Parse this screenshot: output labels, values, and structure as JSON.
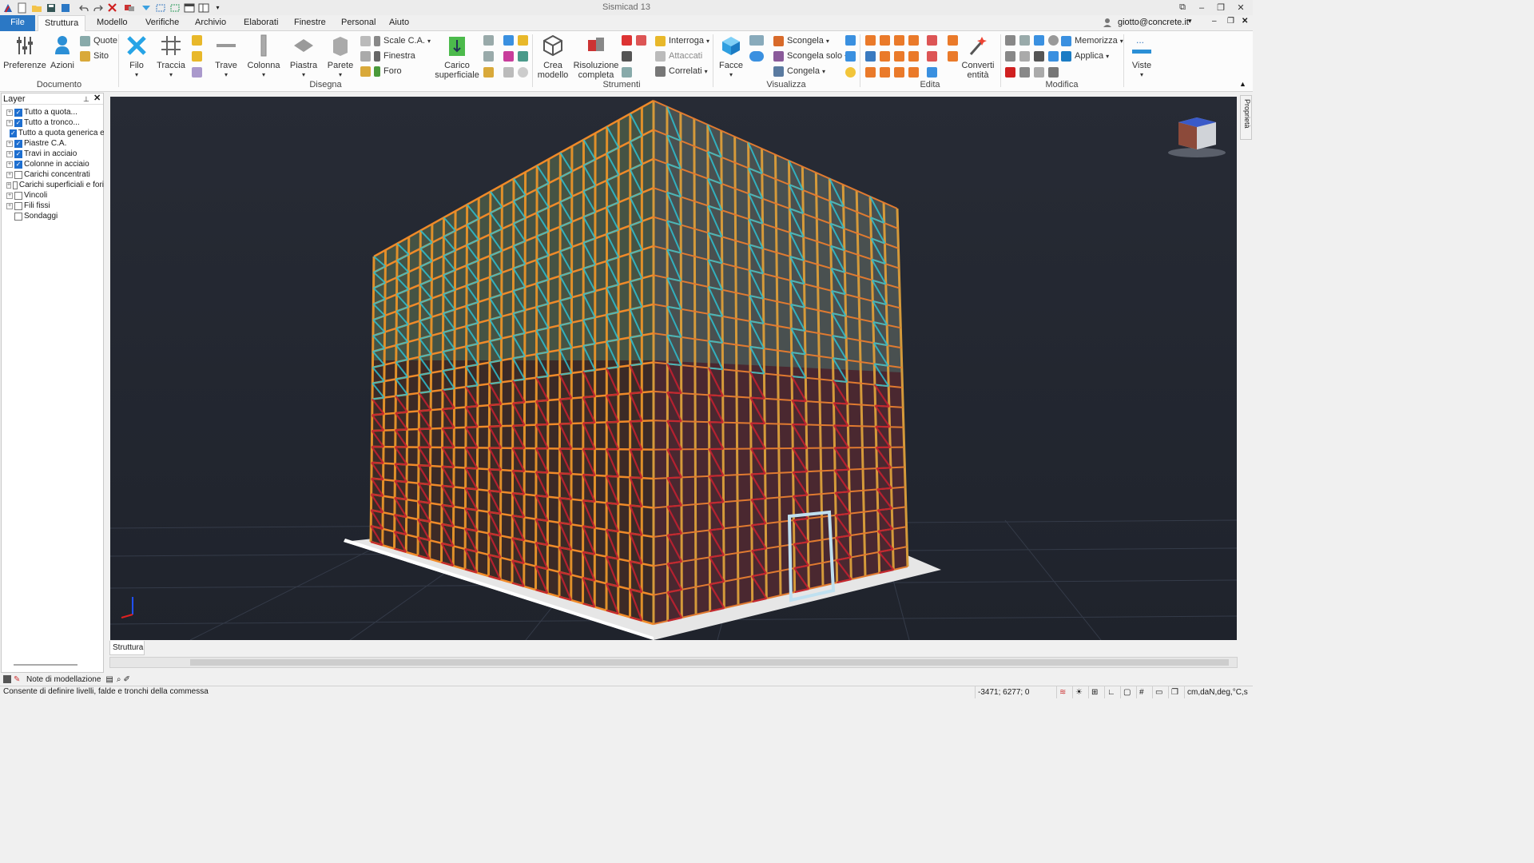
{
  "app": {
    "title": "Sismicad 13",
    "user": "giotto@concrete.it"
  },
  "tabs": [
    {
      "label": "File"
    },
    {
      "label": "Struttura"
    },
    {
      "label": "Modello"
    },
    {
      "label": "Verifiche"
    },
    {
      "label": "Archivio"
    },
    {
      "label": "Elaborati"
    },
    {
      "label": "Finestre"
    },
    {
      "label": "Personal"
    },
    {
      "label": "Aiuto"
    }
  ],
  "ribbon": {
    "groups": {
      "documento": "Documento",
      "disegna": "Disegna",
      "strumenti": "Strumenti",
      "visualizza": "Visualizza",
      "edita": "Edita",
      "modifica": "Modifica"
    },
    "preferenze": "Preferenze",
    "azioni": "Azioni",
    "quote": "Quote",
    "sito": "Sito",
    "filo": "Filo",
    "traccia": "Traccia",
    "trave": "Trave",
    "colonna": "Colonna",
    "piastra": "Piastra",
    "parete": "Parete",
    "scale": "Scale C.A.",
    "finestra": "Finestra",
    "foro": "Foro",
    "carico1": "Carico",
    "carico2": "superficiale",
    "crea1": "Crea",
    "crea2": "modello",
    "risol1": "Risoluzione",
    "risol2": "completa",
    "interroga": "Interroga",
    "attaccati": "Attaccati",
    "correlati": "Correlati",
    "facce": "Facce",
    "scongela": "Scongela",
    "scongela_solo": "Scongela solo",
    "congela": "Congela",
    "converti1": "Converti",
    "converti2": "entità",
    "memorizza": "Memorizza",
    "applica": "Applica",
    "viste": "Viste"
  },
  "layers": {
    "title": "Layer",
    "items": [
      {
        "label": "Tutto a quota...",
        "checked": true,
        "expandable": true
      },
      {
        "label": "Tutto a tronco...",
        "checked": true,
        "expandable": true
      },
      {
        "label": "Tutto a quota generica e",
        "checked": true,
        "expandable": false
      },
      {
        "label": "Piastre C.A.",
        "checked": true,
        "expandable": true
      },
      {
        "label": "Travi in acciaio",
        "checked": true,
        "expandable": true
      },
      {
        "label": "Colonne in acciaio",
        "checked": true,
        "expandable": true
      },
      {
        "label": "Carichi concentrati",
        "checked": false,
        "expandable": true
      },
      {
        "label": "Carichi superficiali e fori",
        "checked": false,
        "expandable": true
      },
      {
        "label": "Vincoli",
        "checked": false,
        "expandable": true
      },
      {
        "label": "Fili fissi",
        "checked": false,
        "expandable": true
      },
      {
        "label": "Sondaggi",
        "checked": false,
        "expandable": false
      }
    ]
  },
  "view": {
    "tab": "Struttura",
    "side_panel": "Proprietà"
  },
  "notes": "Note di modellazione",
  "status": {
    "message": "Consente di definire livelli, falde e tronchi della commessa",
    "coords": "-3471; 6277; 0",
    "units": "cm,daN,deg,°C,s"
  }
}
